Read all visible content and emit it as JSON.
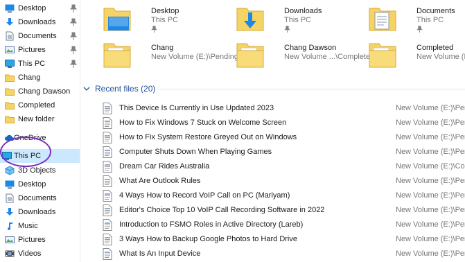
{
  "sidebar": {
    "items": [
      {
        "label": "Desktop",
        "icon": "desktop-icon",
        "pinned": true
      },
      {
        "label": "Downloads",
        "icon": "downloads-icon",
        "pinned": true
      },
      {
        "label": "Documents",
        "icon": "documents-icon",
        "pinned": true
      },
      {
        "label": "Pictures",
        "icon": "pictures-icon",
        "pinned": true
      },
      {
        "label": "This PC",
        "icon": "this-pc-icon",
        "pinned": true
      },
      {
        "label": "Chang",
        "icon": "folder-icon",
        "pinned": false
      },
      {
        "label": "Chang Dawson",
        "icon": "folder-icon",
        "pinned": false
      },
      {
        "label": "Completed",
        "icon": "folder-icon",
        "pinned": false
      },
      {
        "label": "New folder",
        "icon": "folder-icon",
        "pinned": false
      },
      {
        "label": "OneDrive",
        "icon": "onedrive-icon",
        "pinned": false
      },
      {
        "label": "This PC",
        "icon": "this-pc-icon",
        "pinned": false,
        "selected": true
      },
      {
        "label": "3D Objects",
        "icon": "3d-objects-icon",
        "pinned": false
      },
      {
        "label": "Desktop",
        "icon": "desktop-icon",
        "pinned": false
      },
      {
        "label": "Documents",
        "icon": "documents-icon",
        "pinned": false
      },
      {
        "label": "Downloads",
        "icon": "downloads-icon",
        "pinned": false
      },
      {
        "label": "Music",
        "icon": "music-icon",
        "pinned": false
      },
      {
        "label": "Pictures",
        "icon": "pictures-icon",
        "pinned": false
      },
      {
        "label": "Videos",
        "icon": "videos-icon",
        "pinned": false
      }
    ]
  },
  "quick_access": [
    {
      "name": "Desktop",
      "location": "This PC",
      "icon": "desktop-folder-icon",
      "pinned": true
    },
    {
      "name": "Downloads",
      "location": "This PC",
      "icon": "downloads-folder-icon",
      "pinned": true
    },
    {
      "name": "Documents",
      "location": "This PC",
      "icon": "documents-folder-icon",
      "pinned": true
    },
    {
      "name": "Chang",
      "location": "New Volume (E:)\\Pending",
      "icon": "folder-icon",
      "pinned": false
    },
    {
      "name": "Chang Dawson",
      "location": "New Volume ...\\Completed",
      "icon": "folder-icon",
      "pinned": false
    },
    {
      "name": "Completed",
      "location": "New Volume (E:)",
      "icon": "folder-icon",
      "pinned": false
    }
  ],
  "recent": {
    "header": "Recent files (20)",
    "files": [
      {
        "name": "This Device Is Currently in Use Updated 2023",
        "location": "New Volume (E:)\\Pend"
      },
      {
        "name": "How to Fix Windows 7 Stuck on Welcome Screen",
        "location": "New Volume (E:)\\Pend"
      },
      {
        "name": "How to Fix System Restore Greyed Out on Windows",
        "location": "New Volume (E:)\\Pend"
      },
      {
        "name": "Computer Shuts Down When Playing Games",
        "location": "New Volume (E:)\\Pend"
      },
      {
        "name": "Dream Car Rides Australia",
        "location": "New Volume (E:)\\Com"
      },
      {
        "name": "What Are Outlook Rules",
        "location": "New Volume (E:)\\Pend"
      },
      {
        "name": "4 Ways How to Record VoIP Call on PC (Mariyam)",
        "location": "New Volume (E:)\\Pend"
      },
      {
        "name": "Editor's Choice Top 10 VoIP Call Recording Software in 2022",
        "location": "New Volume (E:)\\Pend"
      },
      {
        "name": "Introduction to FSMO Roles in Active Directory (Lareb)",
        "location": "New Volume (E:)\\Pend"
      },
      {
        "name": "3 Ways How to Backup Google Photos to Hard Drive",
        "location": "New Volume (E:)\\Pend"
      },
      {
        "name": "What Is An Input Device",
        "location": "New Volume (E:)\\Pend"
      }
    ]
  },
  "colors": {
    "accent": "#1f4e9c",
    "selection": "#cce8ff",
    "annotation_ring": "#7b2cbf",
    "folder": "#f6d365",
    "muted_text": "#767676"
  }
}
